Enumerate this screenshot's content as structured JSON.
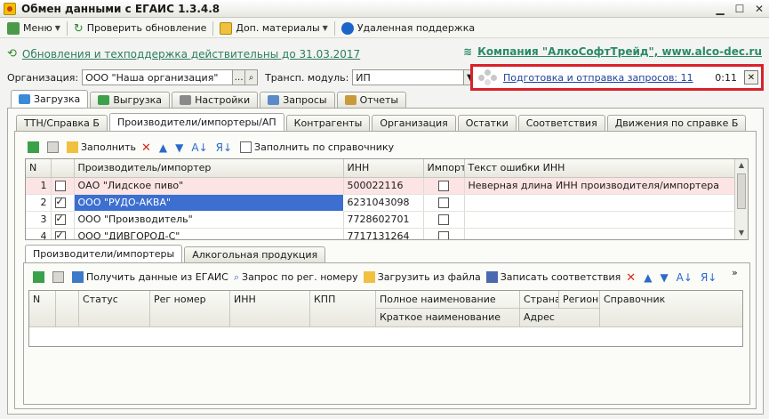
{
  "window": {
    "title": "Обмен данными с ЕГАИС 1.3.4.8"
  },
  "toolbar": {
    "menu": "Меню",
    "check_update": "Проверить обновление",
    "extra_materials": "Доп. материалы",
    "remote_support": "Удаленная поддержка"
  },
  "update": {
    "link": "Обновления и техподдержка действительны до 31.03.2017"
  },
  "company": {
    "link": "Компания \"АлкоСофтТрейд\", www.alco-dec.ru"
  },
  "org": {
    "label": "Организация:",
    "value": "ООО \"Наша организация\"",
    "module_label": "Трансп. модуль:",
    "module_value": "ИП"
  },
  "notification": {
    "text": "Подготовка и отправка запросов: 11",
    "time": "0:11"
  },
  "main_tabs": [
    "Загрузка",
    "Выгрузка",
    "Настройки",
    "Запросы",
    "Отчеты"
  ],
  "sub_tabs": [
    "ТТН/Справка Б",
    "Производители/импортеры/АП",
    "Контрагенты",
    "Организация",
    "Остатки",
    "Соответствия",
    "Движения по справке Б"
  ],
  "upper_toolbar": {
    "fill": "Заполнить",
    "fill_by_ref": "Заполнить по справочнику"
  },
  "upper_grid": {
    "columns": [
      "N",
      "",
      "Производитель/импортер",
      "ИНН",
      "Импорт",
      "Текст ошибки ИНН"
    ],
    "rows": [
      {
        "n": "1",
        "checked": false,
        "name": "ОАО \"Лидское пиво\"",
        "inn": "500022116",
        "import": false,
        "error": "Неверная длина ИНН производителя/импортера"
      },
      {
        "n": "2",
        "checked": true,
        "name": "ООО \"РУДО-АКВА\"",
        "inn": "6231043098",
        "import": false,
        "error": ""
      },
      {
        "n": "3",
        "checked": true,
        "name": "ООО \"Производитель\"",
        "inn": "7728602701",
        "import": false,
        "error": ""
      },
      {
        "n": "4",
        "checked": true,
        "name": "ООО \"ДИВГОРОД-С\"",
        "inn": "7717131264",
        "import": false,
        "error": ""
      }
    ]
  },
  "lower_tabs": [
    "Производители/импортеры",
    "Алкогольная продукция"
  ],
  "lower_toolbar": {
    "get_egais": "Получить данные из ЕГАИС",
    "query_reg": "Запрос по рег. номеру",
    "load_file": "Загрузить из файла",
    "save_match": "Записать соответствия"
  },
  "lower_grid": {
    "n": "N",
    "status": "Статус",
    "reg_number": "Рег номер",
    "inn": "ИНН",
    "kpp": "КПП",
    "full_name": "Полное наименование",
    "short_name": "Краткое наименование",
    "country": "Страна",
    "region": "Регион",
    "address": "Адрес",
    "reference": "Справочник"
  },
  "colors": {
    "alert_border": "#d9212a",
    "selection": "#3c6fd0",
    "link_green": "#2e7d5e",
    "error_row": "#fde4e4"
  }
}
